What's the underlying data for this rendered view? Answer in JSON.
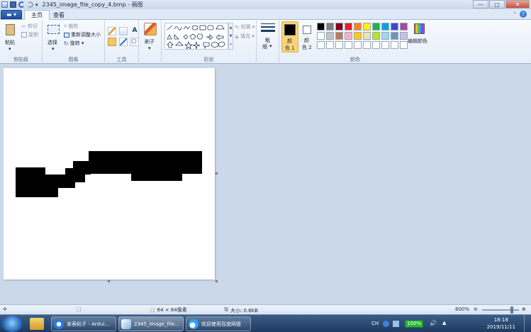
{
  "window": {
    "title": "2345_image_file_copy_4.bmp - 画图",
    "minimize_glyph": "—",
    "maximize_glyph": "□",
    "close_glyph": "✕"
  },
  "menu": {
    "file_glyph": "▬ ▾",
    "tabs": [
      "主页",
      "查看"
    ],
    "help_glyph": "?",
    "collapse_glyph": "⌃"
  },
  "ribbon": {
    "clipboard": {
      "paste": "粘贴",
      "paste_arrow": "▾",
      "cut": "剪切",
      "copy": "复制",
      "label": "剪贴板"
    },
    "image": {
      "select": "选择",
      "select_arrow": "▾",
      "crop": "裁剪",
      "resize": "重新调整大小",
      "rotate": "旋转 ▾",
      "label": "图像"
    },
    "tools": {
      "text_glyph": "A",
      "label": "工具"
    },
    "brushes": {
      "label": "刷子",
      "arrow": "▾"
    },
    "shapes": {
      "outline": "轮廓 ▾",
      "fill": "填充 ▾",
      "label": "形状"
    },
    "size": {
      "label_line1": "粗",
      "label_line2": "细",
      "arrow": "▾"
    },
    "color1": {
      "line1": "颜",
      "line2": "色 1"
    },
    "color2": {
      "line1": "颜",
      "line2": "色 2"
    },
    "edit_colors": "编辑颜色",
    "colors_label": "颜色",
    "accent": "#f7d37a"
  },
  "palette_row1": [
    "#000000",
    "#7f7f7f",
    "#880015",
    "#ed1c24",
    "#ff7f27",
    "#fff200",
    "#22b14c",
    "#00a2e8",
    "#3f48cc",
    "#a349a4"
  ],
  "palette_row2": [
    "#ffffff",
    "#c3c3c3",
    "#b97a57",
    "#ffaec9",
    "#ffc90e",
    "#efe4b0",
    "#b5e61d",
    "#99d9ea",
    "#7092be",
    "#c8bfe7"
  ],
  "status": {
    "dimensions": "64 × 64像素",
    "filesize": "大小: 0.6KB",
    "zoom": "800%"
  },
  "taskbar": {
    "items": [
      "发表帖子 - Ardui...",
      "2345_image_file...",
      "欢迎使用百度网盘"
    ],
    "tray_lang": "CH",
    "battery": "100%",
    "time": "18:18",
    "date": "2019/11/11"
  }
}
